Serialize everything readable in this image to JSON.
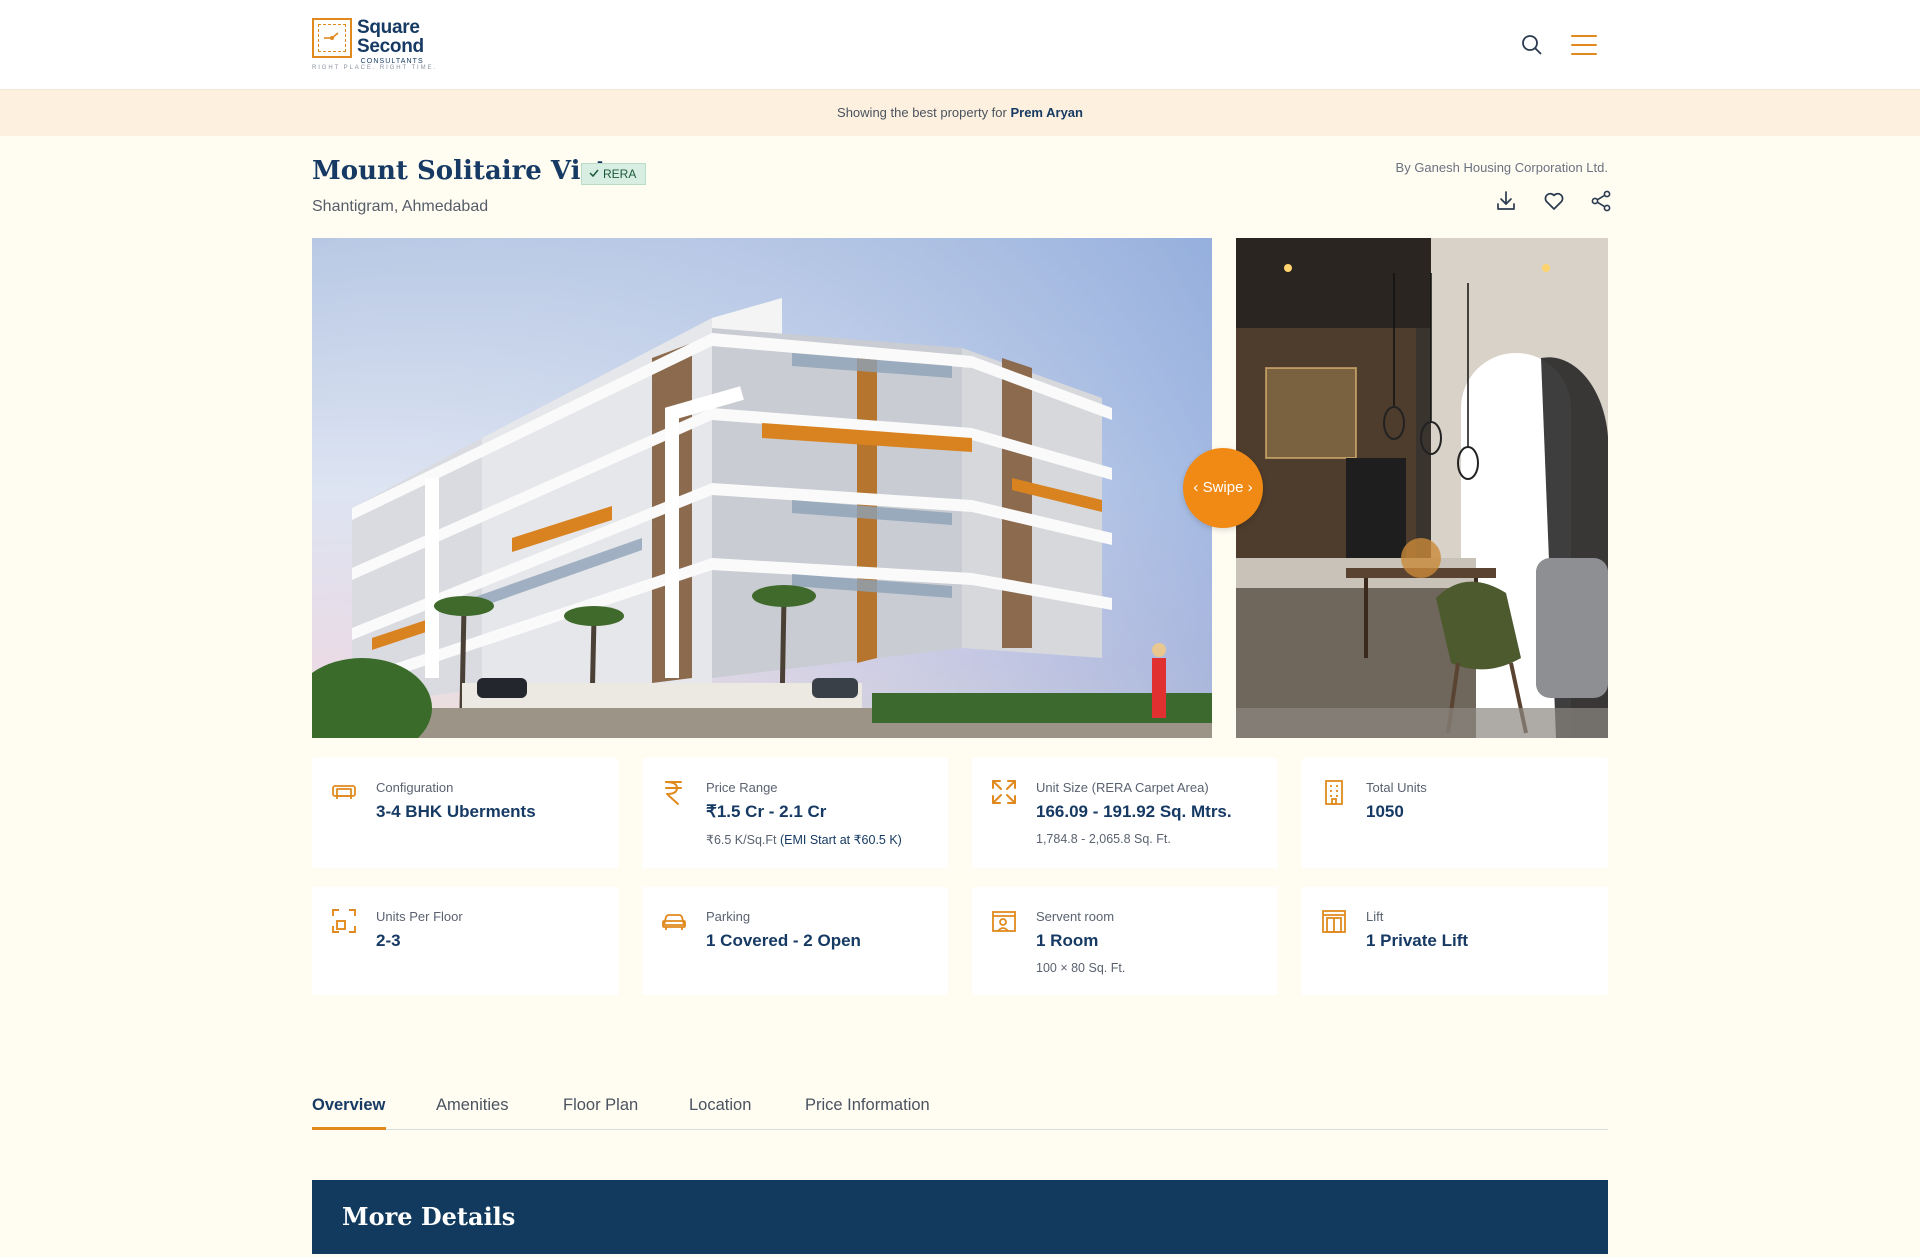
{
  "header": {
    "logo": {
      "line1": "Square",
      "line2": "Second",
      "line3": "CONSULTANTS",
      "tagline": "RIGHT PLACE. RIGHT TIME."
    },
    "search_icon": "search-icon",
    "menu_icon": "hamburger-menu-icon"
  },
  "banner": {
    "prefix": "Showing the best property for ",
    "name": "Prem Aryan"
  },
  "property": {
    "title": "Mount Solitaire Vista",
    "rera_label": "RERA",
    "location": "Shantigram, Ahmedabad",
    "developer": "By Ganesh Housing Corporation Ltd."
  },
  "actions": {
    "download_icon": "download-icon",
    "favorite_icon": "heart-icon",
    "share_icon": "share-icon"
  },
  "gallery": {
    "swipe_label": "Swipe",
    "main_image": "building-exterior-render",
    "side_image": "interior-kitchen-dining-render"
  },
  "cards": [
    {
      "icon": "sofa-icon",
      "label": "Configuration",
      "value": "3-4 BHK Uberments",
      "sub": ""
    },
    {
      "icon": "rupee-icon",
      "label": "Price Range",
      "value": "₹1.5 Cr - 2.1 Cr",
      "sub": "₹6.5 K/Sq.Ft",
      "sub_extra": "(EMI Start at ₹60.5 K)"
    },
    {
      "icon": "expand-icon",
      "label": "Unit Size (RERA Carpet Area)",
      "value": "166.09 - 191.92 Sq. Mtrs.",
      "sub": "1,784.8 - 2,065.8 Sq. Ft."
    },
    {
      "icon": "building-icon",
      "label": "Total Units",
      "value": "1050",
      "sub": ""
    },
    {
      "icon": "floor-units-icon",
      "label": "Units Per Floor",
      "value": "2-3",
      "sub": ""
    },
    {
      "icon": "car-icon",
      "label": "Parking",
      "value": "1 Covered - 2 Open",
      "sub": ""
    },
    {
      "icon": "servant-room-icon",
      "label": "Servent room",
      "value": "1 Room",
      "sub": "100 × 80 Sq. Ft."
    },
    {
      "icon": "lift-icon",
      "label": "Lift",
      "value": "1 Private Lift",
      "sub": ""
    }
  ],
  "tabs": [
    {
      "label": "Overview",
      "active": true
    },
    {
      "label": "Amenities",
      "active": false
    },
    {
      "label": "Floor Plan",
      "active": false
    },
    {
      "label": "Location",
      "active": false
    },
    {
      "label": "Price Information",
      "active": false
    }
  ],
  "more_details": {
    "title": "More Details"
  },
  "colors": {
    "accent": "#e08a1e",
    "navy": "#163a63",
    "banner_bg": "#fdf0de",
    "page_bg": "#fffcf2",
    "swipe": "#f08a14"
  }
}
